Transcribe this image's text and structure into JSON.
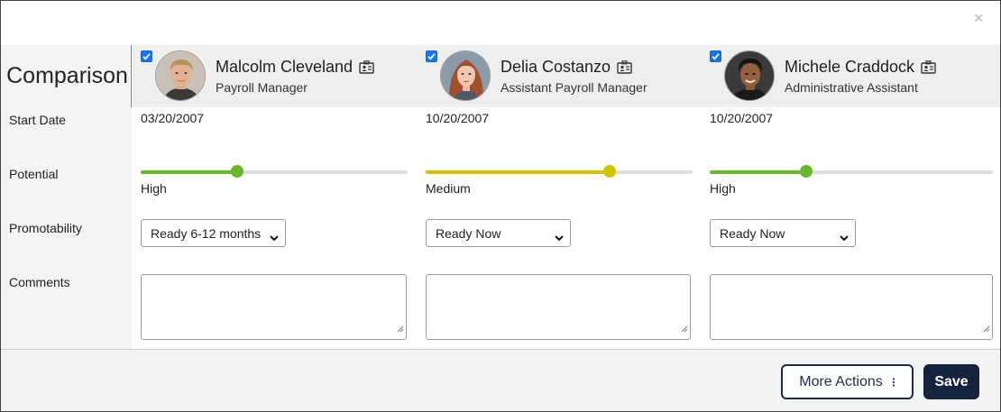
{
  "dialog": {
    "close_icon": "close-icon",
    "title": "Comparison"
  },
  "row_labels": {
    "start_date": "Start Date",
    "potential": "Potential",
    "promotability": "Promotability",
    "comments": "Comments"
  },
  "people": [
    {
      "name": "Malcolm Cleveland",
      "title": "Payroll Manager",
      "checked": true,
      "start_date": "03/20/2007",
      "potential_label": "High",
      "potential_level": 0.36,
      "potential_color": "#6ab52e",
      "promotability": "Ready 6-12 months",
      "comments": ""
    },
    {
      "name": "Delia Costanzo",
      "title": "Assistant Payroll Manager",
      "checked": true,
      "start_date": "10/20/2007",
      "potential_label": "Medium",
      "potential_level": 0.69,
      "potential_color": "#d0c400",
      "promotability": "Ready Now",
      "comments": ""
    },
    {
      "name": "Michele Craddock",
      "title": "Administrative Assistant",
      "checked": true,
      "start_date": "10/20/2007",
      "potential_label": "High",
      "potential_level": 0.34,
      "potential_color": "#6ab52e",
      "promotability": "Ready Now",
      "comments": ""
    }
  ],
  "footer": {
    "more_actions_label": "More Actions",
    "save_label": "Save"
  },
  "colors": {
    "primary_dark": "#16233f",
    "checkbox_blue": "#1a73e8",
    "high": "#6ab52e",
    "medium": "#d0c400"
  }
}
